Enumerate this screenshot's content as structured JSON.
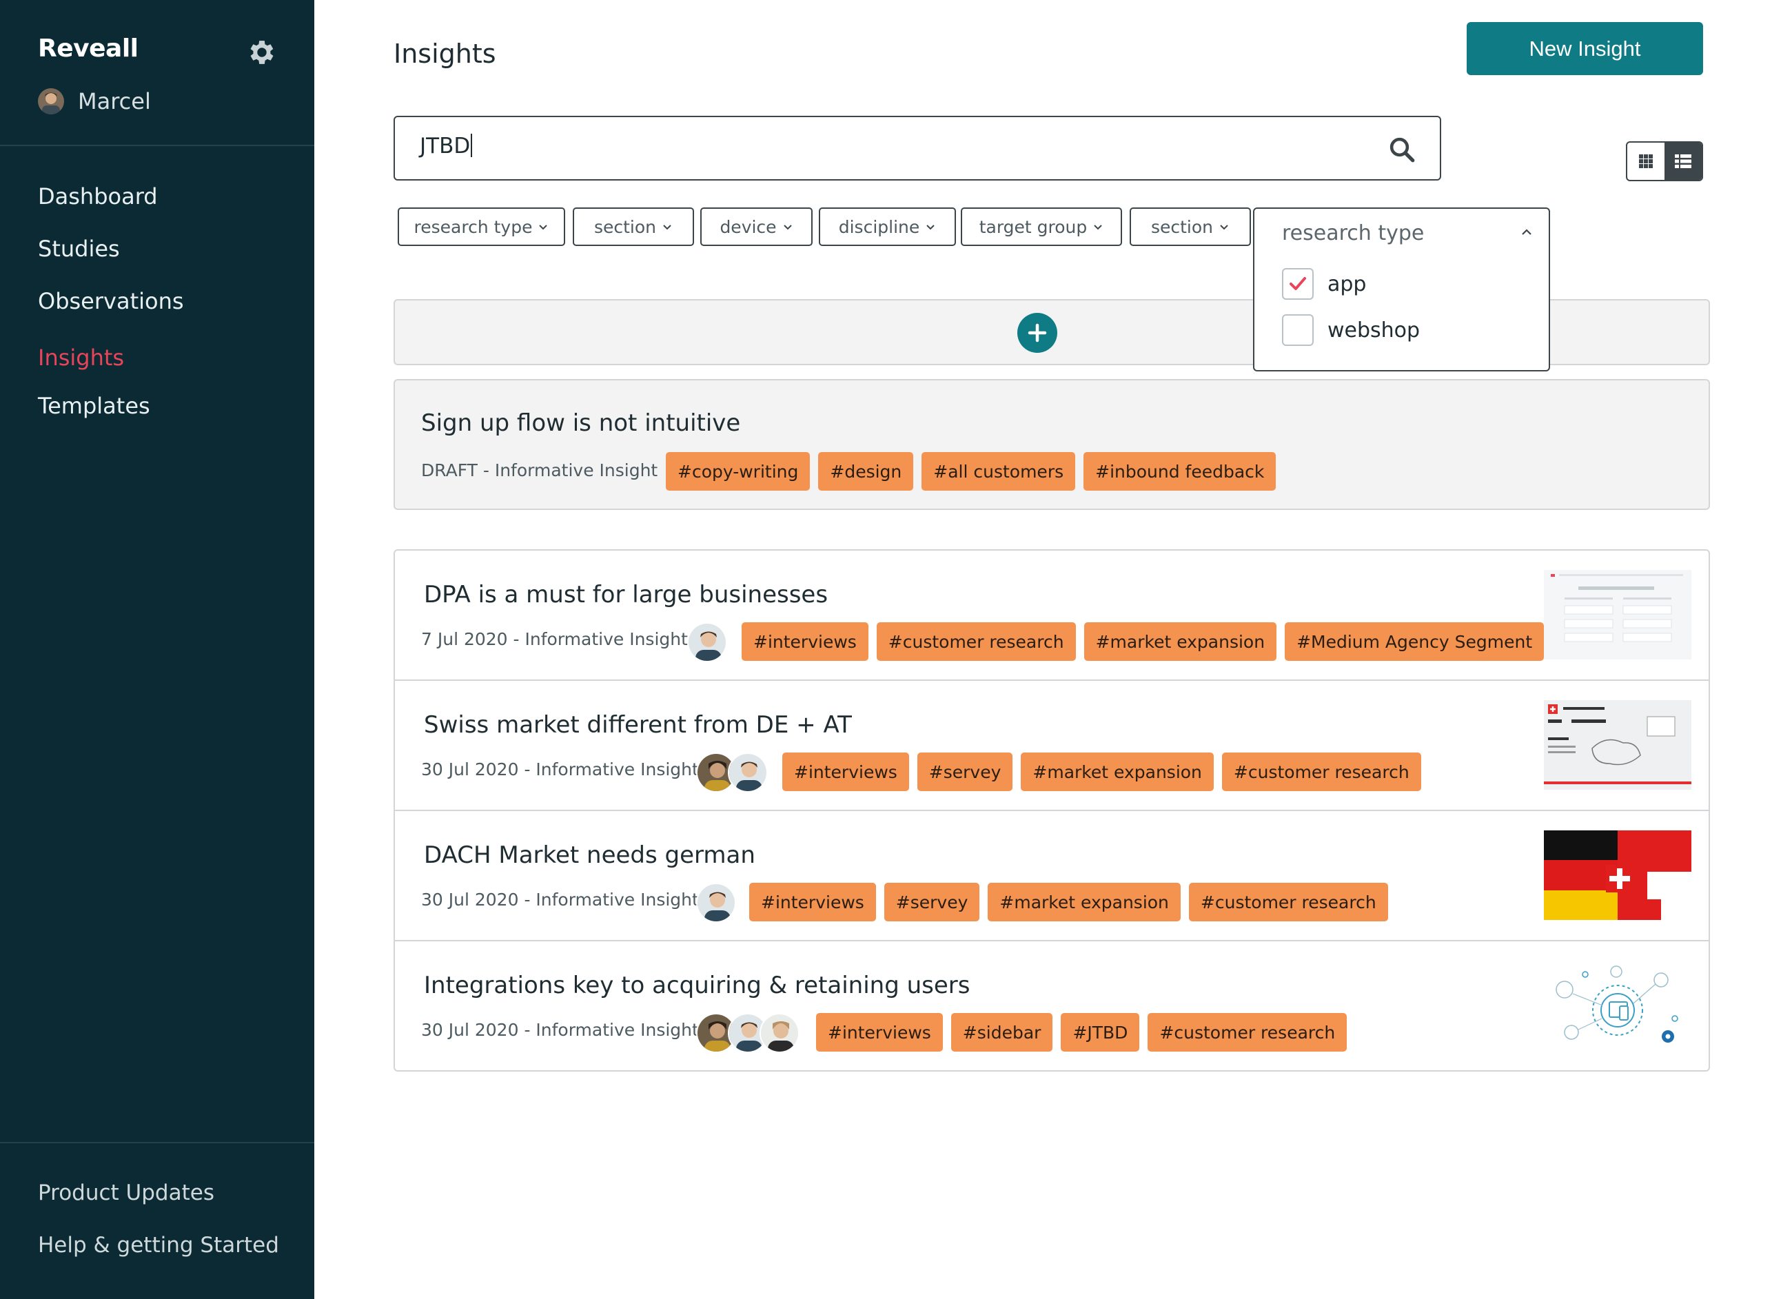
{
  "sidebar": {
    "brand": "Reveall",
    "user_name": "Marcel",
    "nav": [
      {
        "label": "Dashboard",
        "active": false
      },
      {
        "label": "Studies",
        "active": false
      },
      {
        "label": "Observations",
        "active": false
      },
      {
        "label": "Insights",
        "active": true
      },
      {
        "label": "Templates",
        "active": false
      }
    ],
    "bottom": [
      "Product Updates",
      "Help & getting Started"
    ]
  },
  "header": {
    "title": "Insights",
    "new_button": "New Insight"
  },
  "search": {
    "value": "JTBD"
  },
  "view_toggle": {
    "active": "list"
  },
  "filters": [
    "research type",
    "section",
    "device",
    "discipline",
    "target group",
    "section"
  ],
  "dropdown": {
    "title": "research type",
    "options": [
      {
        "label": "app",
        "checked": true
      },
      {
        "label": "webshop",
        "checked": false
      }
    ]
  },
  "draft": {
    "title": "Sign up flow is not intuitive",
    "meta": "DRAFT - Informative Insight",
    "tags": [
      "#copy-writing",
      "#design",
      "#all customers",
      "#inbound feedback"
    ]
  },
  "insights": [
    {
      "title": "DPA is a must for large businesses",
      "meta": "7 Jul 2020 - Informative Insight",
      "avatars": 1,
      "tags": [
        "#interviews",
        "#customer research",
        "#market expansion",
        "#Medium Agency Segment"
      ]
    },
    {
      "title": "Swiss market different from DE + AT",
      "meta": "30 Jul 2020 - Informative Insight",
      "avatars": 2,
      "tags": [
        "#interviews",
        "#servey",
        "#market expansion",
        "#customer research"
      ]
    },
    {
      "title": "DACH Market needs german",
      "meta": "30 Jul 2020 - Informative Insight",
      "avatars": 1,
      "tags": [
        "#interviews",
        "#servey",
        "#market expansion",
        "#customer research"
      ]
    },
    {
      "title": "Integrations key to acquiring & retaining users",
      "meta": "30 Jul 2020 - Informative Insight",
      "avatars": 3,
      "tags": [
        "#interviews",
        "#sidebar",
        "#JTBD",
        "#customer research"
      ]
    }
  ],
  "colors": {
    "sidebar_bg": "#0c2a33",
    "accent": "#0f7b84",
    "active_nav": "#e8445a",
    "tag_bg": "#f4924f"
  }
}
